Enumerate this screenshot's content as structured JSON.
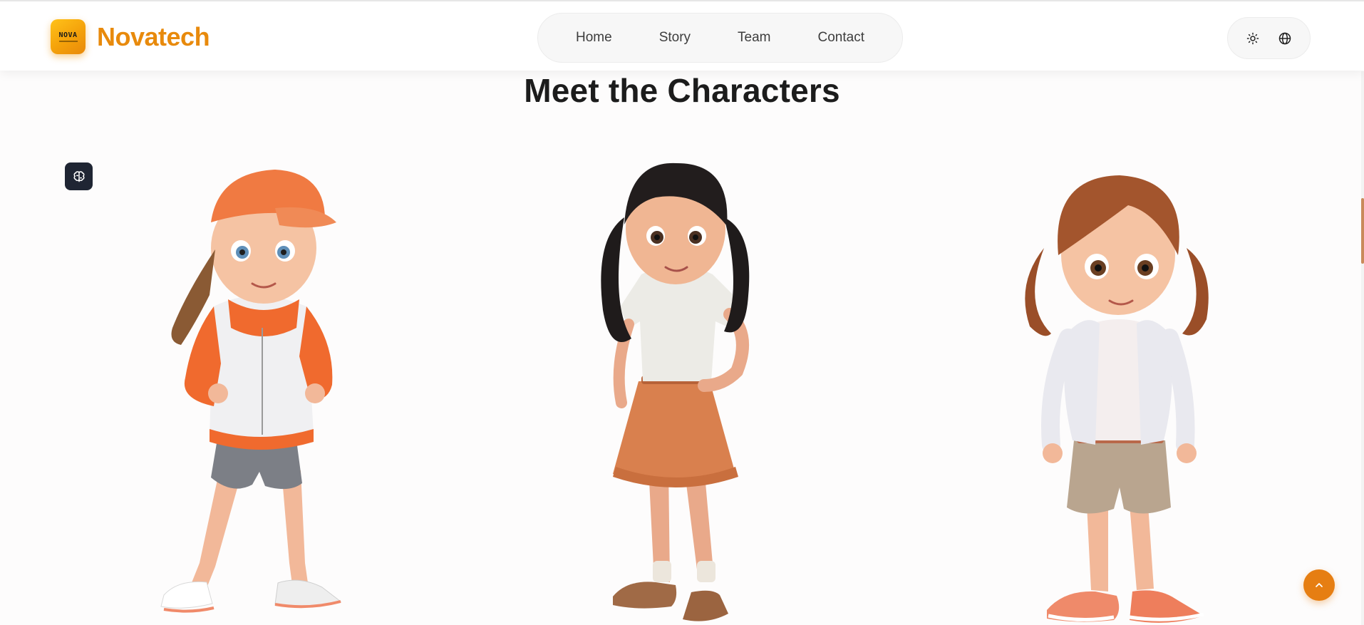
{
  "brand": {
    "logo_text": "NOVA",
    "name": "Novatech"
  },
  "nav": {
    "items": [
      {
        "label": "Home"
      },
      {
        "label": "Story"
      },
      {
        "label": "Team"
      },
      {
        "label": "Contact"
      }
    ]
  },
  "tools": {
    "theme_icon": "sun-icon",
    "language_icon": "globe-icon"
  },
  "section": {
    "title": "Meet the Characters"
  },
  "characters": [
    {
      "name": "",
      "style": "orange cap, orange hoodie, grey shorts"
    },
    {
      "name": "",
      "style": "white polo, orange pleated skirt"
    },
    {
      "name": "",
      "style": "auburn hair, white jacket, khaki shorts"
    }
  ],
  "colors": {
    "accent": "#e88a0c",
    "back_to_top": "#e67e12",
    "ai_chip": "#1f2533"
  },
  "floating": {
    "ai_icon": "brain-icon",
    "back_to_top_icon": "chevron-up-icon"
  }
}
